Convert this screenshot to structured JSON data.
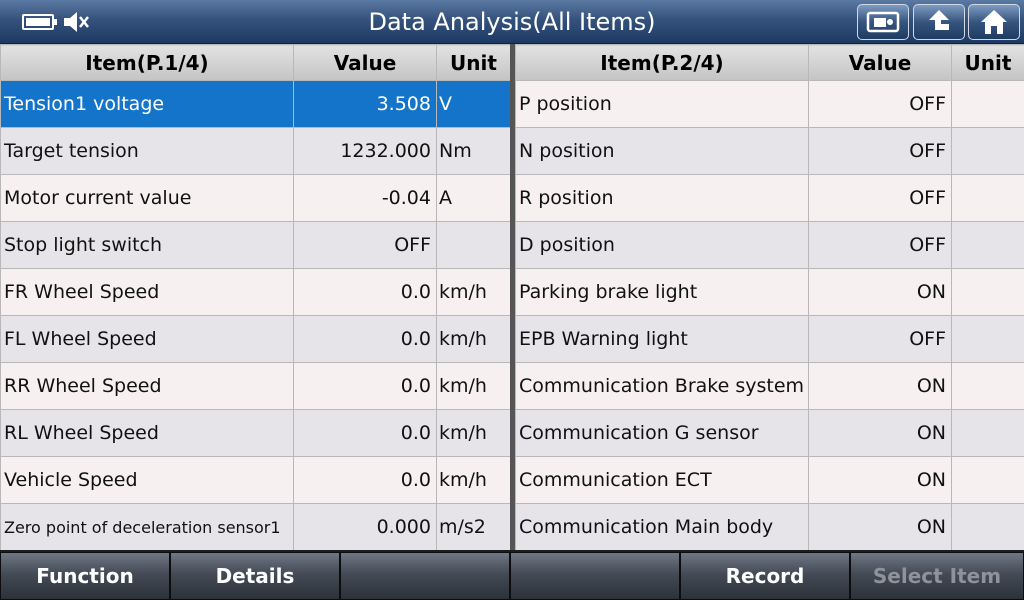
{
  "header": {
    "title": "Data Analysis(All Items)"
  },
  "left_table": {
    "columns": [
      "Item(P.1/4)",
      "Value",
      "Unit"
    ],
    "rows": [
      {
        "item": "Tension1 voltage",
        "value": "3.508",
        "unit": "V"
      },
      {
        "item": "Target tension",
        "value": "1232.000",
        "unit": "Nm"
      },
      {
        "item": "Motor current value",
        "value": "-0.04",
        "unit": "A"
      },
      {
        "item": "Stop light switch",
        "value": "OFF",
        "unit": ""
      },
      {
        "item": "FR Wheel Speed",
        "value": "0.0",
        "unit": "km/h"
      },
      {
        "item": "FL Wheel Speed",
        "value": "0.0",
        "unit": "km/h"
      },
      {
        "item": "RR Wheel Speed",
        "value": "0.0",
        "unit": "km/h"
      },
      {
        "item": "RL Wheel Speed",
        "value": "0.0",
        "unit": "km/h"
      },
      {
        "item": "Vehicle Speed",
        "value": "0.0",
        "unit": "km/h"
      },
      {
        "item": "Zero point of deceleration sensor1",
        "value": "0.000",
        "unit": "m/s2"
      }
    ]
  },
  "right_table": {
    "columns": [
      "Item(P.2/4)",
      "Value",
      "Unit"
    ],
    "rows": [
      {
        "item": "P position",
        "value": "OFF",
        "unit": ""
      },
      {
        "item": "N position",
        "value": "OFF",
        "unit": ""
      },
      {
        "item": "R position",
        "value": "OFF",
        "unit": ""
      },
      {
        "item": "D position",
        "value": "OFF",
        "unit": ""
      },
      {
        "item": "Parking brake light",
        "value": "ON",
        "unit": ""
      },
      {
        "item": "EPB Warning light",
        "value": "OFF",
        "unit": ""
      },
      {
        "item": "Communication Brake system",
        "value": "ON",
        "unit": ""
      },
      {
        "item": "Communication G sensor",
        "value": "ON",
        "unit": ""
      },
      {
        "item": "Communication ECT",
        "value": "ON",
        "unit": ""
      },
      {
        "item": "Communication Main body",
        "value": "ON",
        "unit": ""
      }
    ]
  },
  "toolbar": {
    "buttons": [
      {
        "label": "Function",
        "enabled": true
      },
      {
        "label": "Details",
        "enabled": true
      },
      {
        "label": "",
        "enabled": true
      },
      {
        "label": "",
        "enabled": true
      },
      {
        "label": "Record",
        "enabled": true
      },
      {
        "label": "Select Item",
        "enabled": false
      }
    ]
  },
  "icons": {
    "status": [
      "battery-icon",
      "mute-icon"
    ],
    "header_buttons": [
      "screenshot-icon",
      "back-icon",
      "home-icon"
    ]
  },
  "colors": {
    "selected_row": "#1474c9",
    "title_bar": "#34527c"
  }
}
